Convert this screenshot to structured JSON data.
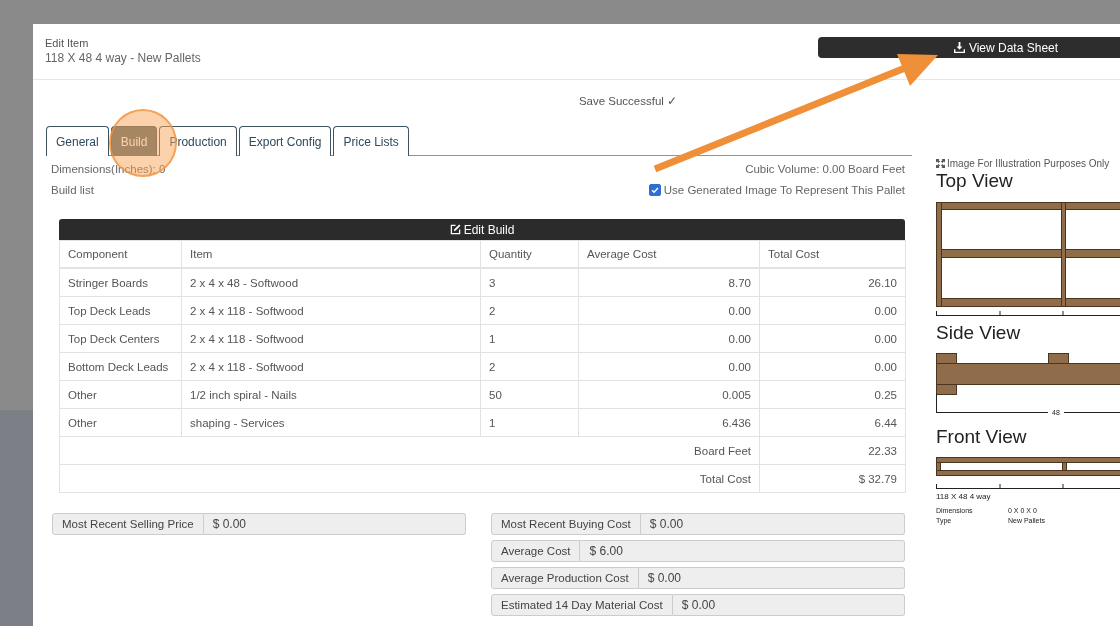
{
  "dialog": {
    "title": "Edit Item",
    "subtitle": "118 X 48 4 way - New Pallets",
    "action_button": {
      "label": "View Data Sheet",
      "pointed_at": true
    },
    "status_message": "Save Successful ✓"
  },
  "tabs": [
    {
      "label": "General",
      "selected": false,
      "highlighted": false
    },
    {
      "label": "Build",
      "selected": true,
      "highlighted": true
    },
    {
      "label": "Production",
      "selected": false,
      "highlighted": false
    },
    {
      "label": "Export Config",
      "selected": false,
      "highlighted": false
    },
    {
      "label": "Price Lists",
      "selected": false,
      "highlighted": false
    }
  ],
  "build": {
    "dimensions": "Dimensions(Inches): 0",
    "cubic_volume": "Cubic Volume: 0.00 Board Feet",
    "section_label": "Build list",
    "use_generated_image": {
      "label": "Use Generated Image To Represent This Pallet",
      "checked": true
    },
    "edit_button": {
      "label": "Edit Build"
    }
  },
  "table": {
    "columns": [
      "Component",
      "Item",
      "Quantity",
      "Average Cost",
      "Total Cost"
    ],
    "rows": [
      [
        "Stringer Boards",
        "2 x 4 x 48 - Softwood",
        "3",
        "8.70",
        "26.10"
      ],
      [
        "Top Deck Leads",
        "2 x 4 x 118 - Softwood",
        "2",
        "0.00",
        "0.00"
      ],
      [
        "Top Deck Centers",
        "2 x 4 x 118 - Softwood",
        "1",
        "0.00",
        "0.00"
      ],
      [
        "Bottom Deck Leads",
        "2 x 4 x 118 - Softwood",
        "2",
        "0.00",
        "0.00"
      ],
      [
        "Other",
        "1/2 inch spiral - Nails",
        "50",
        "0.005",
        "0.25"
      ],
      [
        "Other",
        "shaping - Services",
        "1",
        "6.436",
        "6.44"
      ]
    ],
    "summary_rows": [
      {
        "label": "Board Feet",
        "value": "22.33"
      },
      {
        "label": "Total Cost",
        "value": "$ 32.79"
      }
    ]
  },
  "cost_fields_left": [
    {
      "label": "Most Recent Selling Price",
      "value": "$ 0.00"
    }
  ],
  "cost_fields_right": [
    {
      "label": "Most Recent Buying Cost",
      "value": "$ 0.00"
    },
    {
      "label": "Average Cost",
      "value": "$ 6.00"
    },
    {
      "label": "Average Production Cost",
      "value": "$ 0.00"
    },
    {
      "label": "Estimated 14 Day Material Cost",
      "value": "$ 0.00"
    }
  ],
  "preview": {
    "note": "Image For Illustration Purposes Only",
    "views": [
      {
        "kind": "top",
        "title": "Top View"
      },
      {
        "kind": "side",
        "title": "Side View",
        "dimension_label": "48"
      },
      {
        "kind": "front",
        "title": "Front View"
      }
    ],
    "caption": "118 X 48 4 way",
    "specs": [
      {
        "label": "Dimensions",
        "value": "0 X 0 X 0"
      },
      {
        "label": "Type",
        "value": "New Pallets"
      }
    ]
  }
}
